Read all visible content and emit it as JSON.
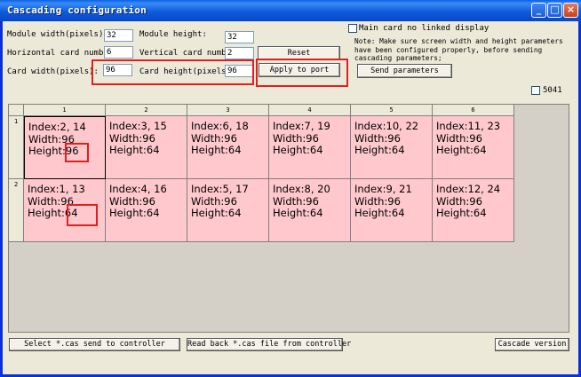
{
  "window": {
    "title": "Cascading configuration",
    "controls": {
      "minimize": "_",
      "maximize": "□",
      "close": "×"
    }
  },
  "form": {
    "module_width_label": "Module width(pixels):",
    "module_width_value": "32",
    "module_height_label": "Module height:",
    "module_height_value": "32",
    "horizontal_label": "Horizontal card number:",
    "horizontal_value": "6",
    "vertical_label": "Vertical card number:",
    "vertical_value": "2",
    "card_width_label": "Card width(pixels):",
    "card_width_value": "96",
    "card_height_label": "Card height(pixels):",
    "card_height_value": "96",
    "reset_label": "Reset",
    "apply_label": "Apply to port",
    "send_params_label": "Send parameters",
    "main_card_label": "Main card no linked display",
    "main_card_checked": false,
    "note": "Note: Make sure screen width and height parameters have been configured properly, before sending cascading parameters;",
    "opt_5041_label": "5041",
    "opt_5041_checked": false
  },
  "grid": {
    "columns": [
      "1",
      "2",
      "3",
      "4",
      "5",
      "6"
    ],
    "rows": [
      {
        "label": "1",
        "cells": [
          {
            "index": "Index:2, 14",
            "width": "Width:96",
            "height": "Height:96"
          },
          {
            "index": "Index:3, 15",
            "width": "Width:96",
            "height": "Height:64"
          },
          {
            "index": "Index:6, 18",
            "width": "Width:96",
            "height": "Height:64"
          },
          {
            "index": "Index:7, 19",
            "width": "Width:96",
            "height": "Height:64"
          },
          {
            "index": "Index:10, 22",
            "width": "Width:96",
            "height": "Height:64"
          },
          {
            "index": "Index:11, 23",
            "width": "Width:96",
            "height": "Height:64"
          }
        ]
      },
      {
        "label": "2",
        "cells": [
          {
            "index": "Index:1, 13",
            "width": "Width:96",
            "height": "Height:64"
          },
          {
            "index": "Index:4, 16",
            "width": "Width:96",
            "height": "Height:64"
          },
          {
            "index": "Index:5, 17",
            "width": "Width:96",
            "height": "Height:64"
          },
          {
            "index": "Index:8, 20",
            "width": "Width:96",
            "height": "Height:64"
          },
          {
            "index": "Index:9, 21",
            "width": "Width:96",
            "height": "Height:64"
          },
          {
            "index": "Index:12, 24",
            "width": "Width:96",
            "height": "Height:64"
          }
        ]
      }
    ]
  },
  "bottom": {
    "select_send_label": "Select *.cas send to controller",
    "read_back_label": "Read back *.cas file from controller",
    "cascade_version_label": "Cascade version"
  },
  "colors": {
    "cell_bg": "#FFC8CC",
    "highlight": "#E02020",
    "titlebar": "#0A5FE8",
    "dialog_bg": "#ECE9D8"
  }
}
